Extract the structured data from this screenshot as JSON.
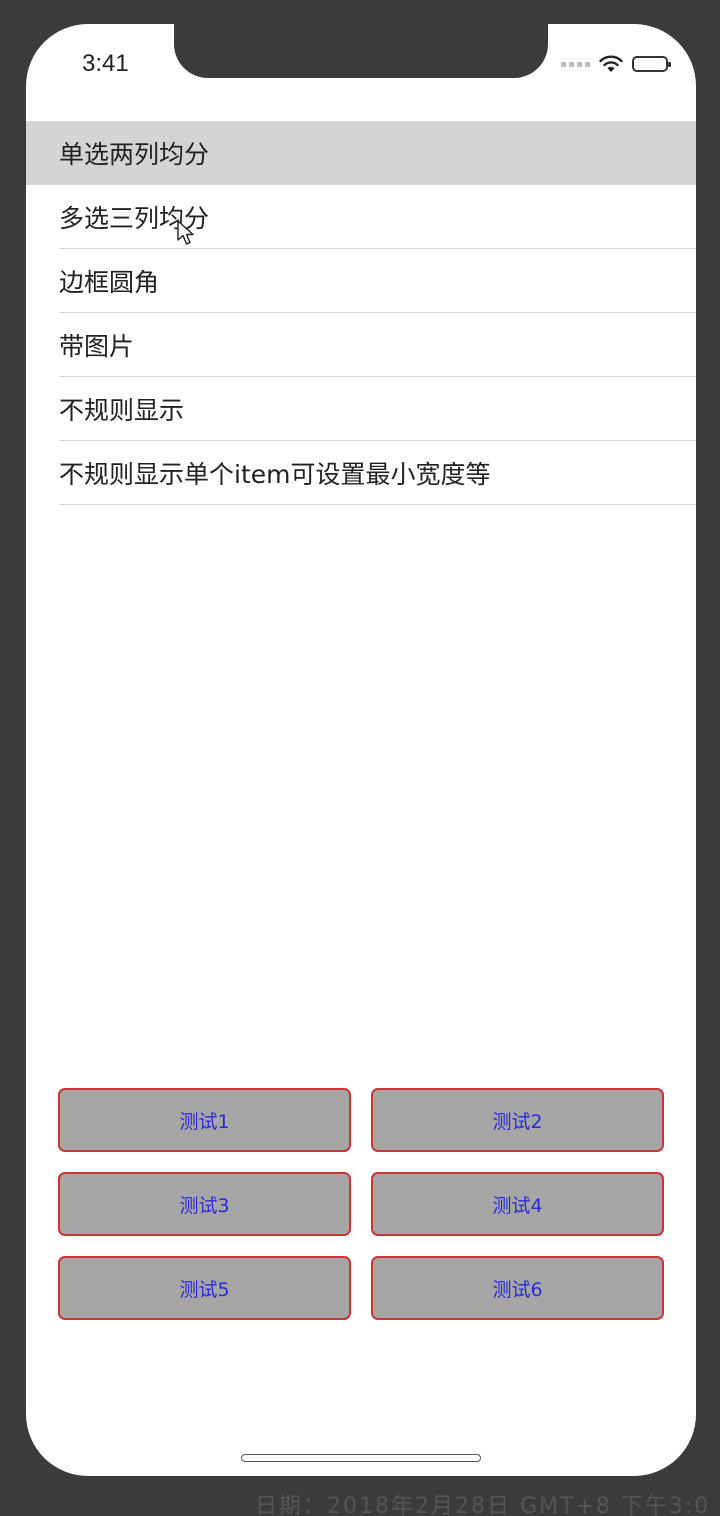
{
  "status_bar": {
    "time": "3:41"
  },
  "list": {
    "items": [
      {
        "label": "单选两列均分",
        "selected": true
      },
      {
        "label": "多选三列均分",
        "selected": false
      },
      {
        "label": "边框圆角",
        "selected": false
      },
      {
        "label": "带图片",
        "selected": false
      },
      {
        "label": "不规则显示",
        "selected": false
      },
      {
        "label": "不规则显示单个item可设置最小宽度等",
        "selected": false
      }
    ]
  },
  "buttons": [
    {
      "label": "测试1"
    },
    {
      "label": "测试2"
    },
    {
      "label": "测试3"
    },
    {
      "label": "测试4"
    },
    {
      "label": "测试5"
    },
    {
      "label": "测试6"
    }
  ],
  "background_text": "日期：2018年2月28日 GMT+8 下午3:0",
  "colors": {
    "selected_row": "#d4d4d4",
    "button_fill": "#a6a6a6",
    "button_border": "#cc3333",
    "button_text": "#2a2ad8",
    "separator": "#d6d6d6"
  },
  "icons": [
    "wifi-icon",
    "battery-icon",
    "signal-dots-icon",
    "mouse-cursor-icon"
  ]
}
